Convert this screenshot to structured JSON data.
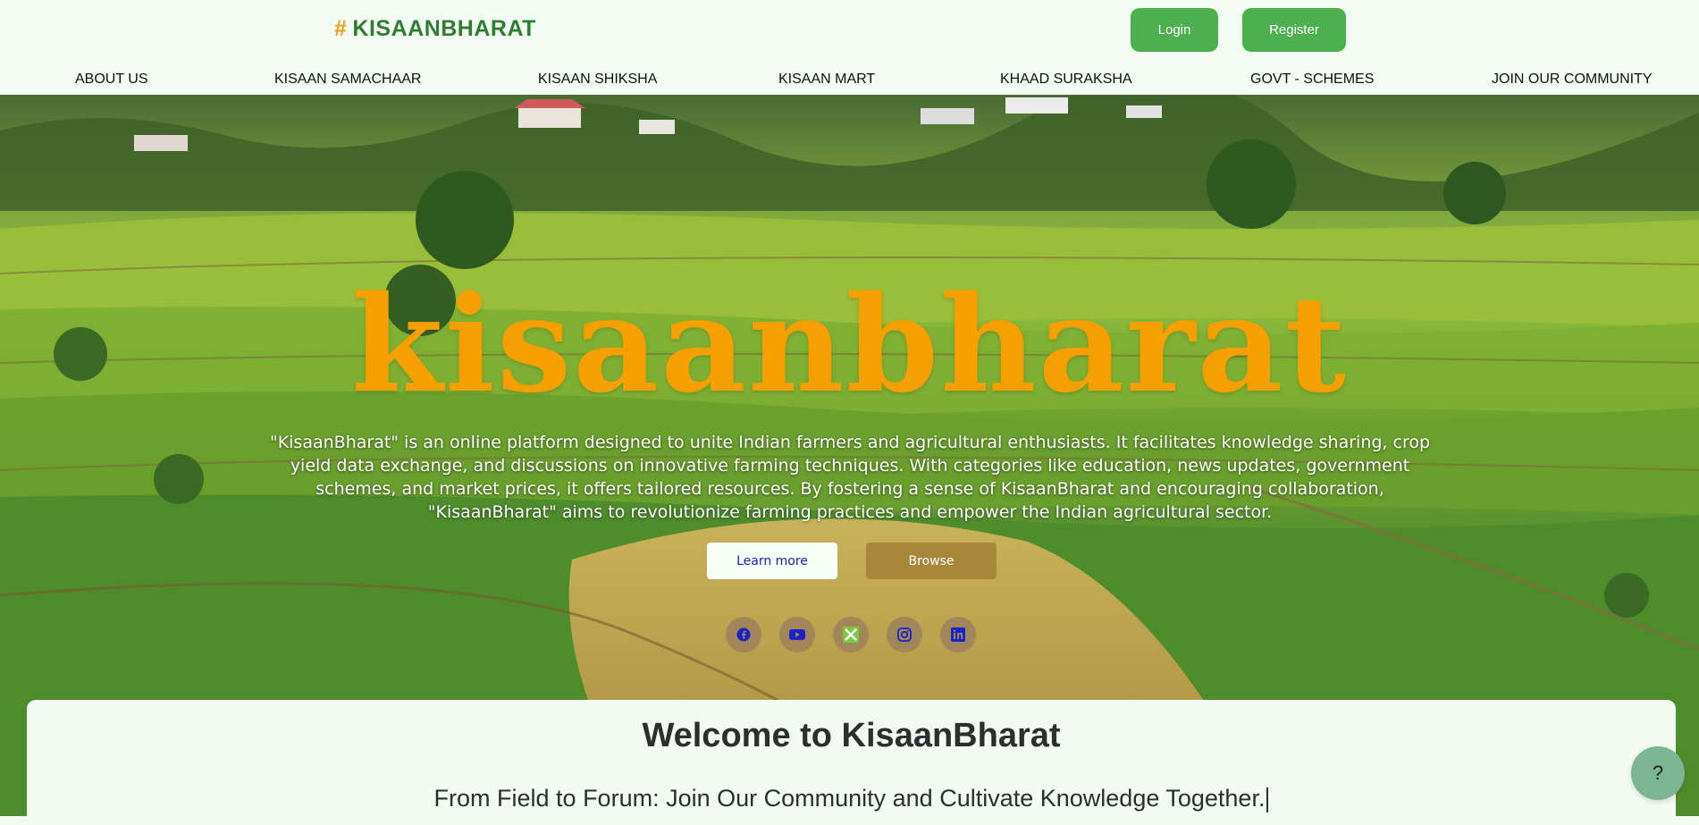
{
  "header": {
    "brand_hash": "#",
    "brand": "KISAANBHARAT",
    "login_label": "Login",
    "register_label": "Register"
  },
  "nav": {
    "items": [
      {
        "label": "ABOUT US"
      },
      {
        "label": "KISAAN SAMACHAAR"
      },
      {
        "label": "KISAAN SHIKSHA"
      },
      {
        "label": "KISAAN MART"
      },
      {
        "label": "KHAAD SURAKSHA"
      },
      {
        "label": "GOVT - SCHEMES"
      },
      {
        "label": "JOIN OUR COMMUNITY"
      }
    ]
  },
  "hero": {
    "title": "kisaanbharat",
    "description": "\"KisaanBharat\" is an online platform designed to unite Indian farmers and agricultural enthusiasts. It facilitates knowledge sharing, crop yield data exchange, and discussions on innovative farming techniques. With categories like education, news updates, government schemes, and market prices, it offers tailored resources. By fostering a sense of KisaanBharat and encouraging collaboration, \"KisaanBharat\" aims to revolutionize farming practices and empower the Indian agricultural sector.",
    "learn_more_label": "Learn more",
    "browse_label": "Browse",
    "social_icons": [
      "facebook-icon",
      "youtube-icon",
      "x-icon",
      "instagram-icon",
      "linkedin-icon"
    ]
  },
  "welcome": {
    "title": "Welcome to KisaanBharat",
    "subtitle": "From Field to Forum: Join Our Community and Cultivate Knowledge Together."
  },
  "help": {
    "label": "?"
  },
  "colors": {
    "brand_green": "#2f7d32",
    "button_green": "#4caf50",
    "hero_title": "#f5a000",
    "browse_brown": "#a8873a",
    "page_bg": "#f1fbf1"
  }
}
